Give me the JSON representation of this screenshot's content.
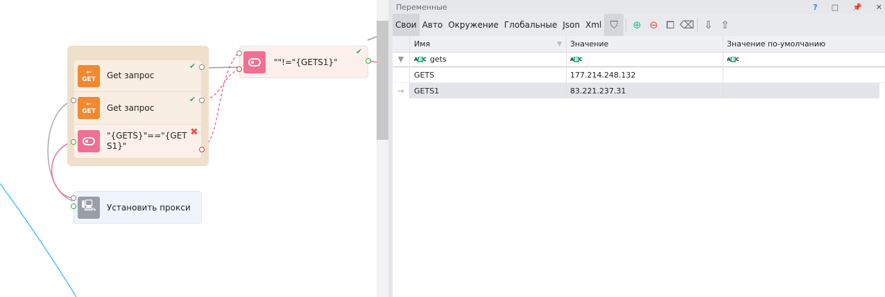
{
  "canvas": {
    "group_items": [
      {
        "label": "Get запрос",
        "icon": "get-request-icon",
        "badge": "GET"
      },
      {
        "label": "Get запрос",
        "icon": "get-request-icon",
        "badge": "GET"
      },
      {
        "label": "\"{GETS}\"==\"{GETS1}\"",
        "icon": "condition-toggle-icon"
      }
    ],
    "condition_node": {
      "label": "\"\"!=\"{GETS1}\""
    },
    "proxy_node": {
      "label": "Установить прокси",
      "icon": "monitor-network-icon"
    }
  },
  "panel": {
    "title": "Переменные",
    "title_icons": [
      "?",
      "□",
      "pin",
      "close"
    ],
    "tabs": [
      "Свои",
      "Авто",
      "Окружение",
      "Глобальные",
      "Json",
      "Xml"
    ],
    "active_tab": "Свои",
    "columns": [
      "Имя",
      "Значение",
      "Значение по-умолчанию"
    ],
    "filter": {
      "name": "gets",
      "value": "",
      "default": ""
    },
    "rows": [
      {
        "name": "GETS",
        "value": "177.214.248.132",
        "default": ""
      },
      {
        "name": "GETS1",
        "value": "83.221.237.31",
        "default": "",
        "selected": true
      }
    ]
  }
}
